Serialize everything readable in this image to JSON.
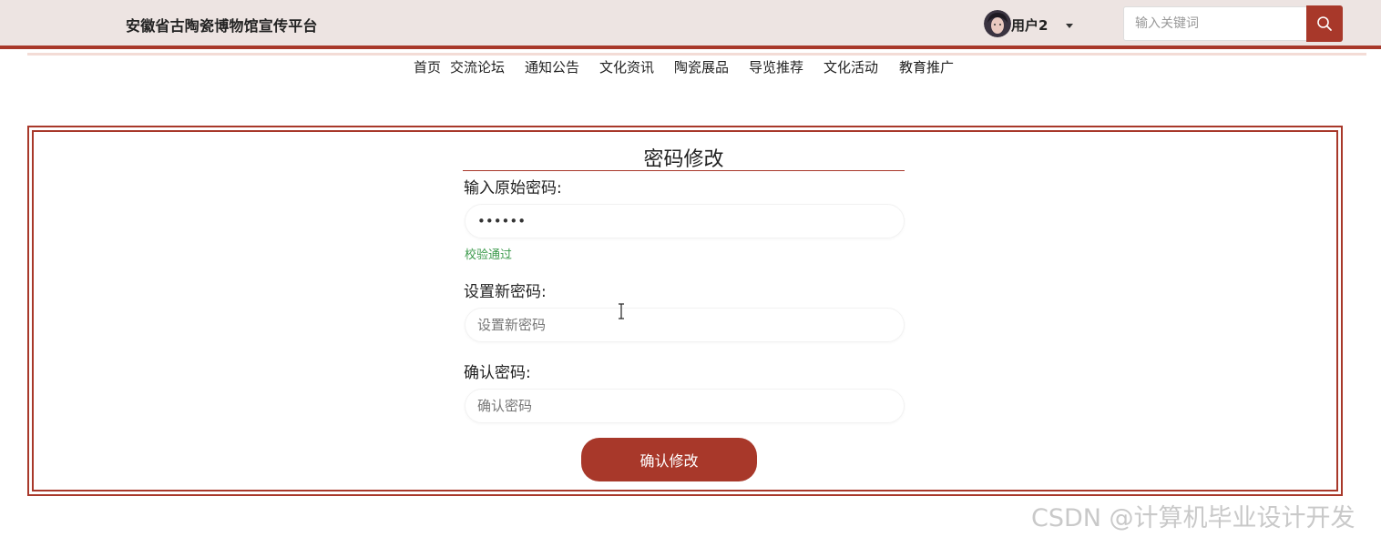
{
  "header": {
    "site_title": "安徽省古陶瓷博物馆宣传平台",
    "user_name": "用户2",
    "search_placeholder": "输入关键词",
    "accent_color": "#a8382a"
  },
  "nav": {
    "items": [
      "首页",
      "交流论坛",
      "通知公告",
      "文化资讯",
      "陶瓷展品",
      "导览推荐",
      "文化活动",
      "教育推广"
    ]
  },
  "form": {
    "title": "密码修改",
    "old_password_label": "输入原始密码:",
    "old_password_value": "••••••",
    "old_password_status": "校验通过",
    "new_password_label": "设置新密码:",
    "new_password_placeholder": "设置新密码",
    "confirm_password_label": "确认密码:",
    "confirm_password_placeholder": "确认密码",
    "submit_label": "确认修改"
  },
  "watermark": "CSDN @计算机毕业设计开发",
  "icons": [
    "avatar",
    "chevron-down-icon",
    "search-icon",
    "text-cursor-icon"
  ]
}
